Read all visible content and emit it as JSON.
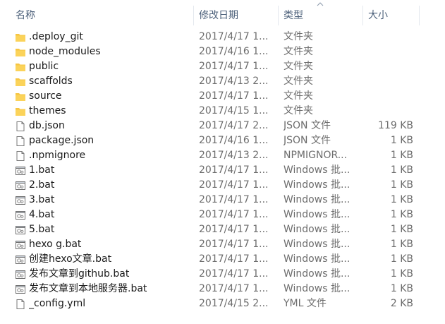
{
  "columns": {
    "name": "名称",
    "date": "修改日期",
    "type": "类型",
    "size": "大小"
  },
  "colors": {
    "header_text": "#4c607a",
    "folder": "#f6c542",
    "name_text": "#1a1a1a",
    "detail_text": "#6d6d6d"
  },
  "files": [
    {
      "name": ".deploy_git",
      "date": "2017/4/17 1...",
      "type": "文件夹",
      "size": "",
      "icon": "folder-icon"
    },
    {
      "name": "node_modules",
      "date": "2017/4/16 1...",
      "type": "文件夹",
      "size": "",
      "icon": "folder-icon"
    },
    {
      "name": "public",
      "date": "2017/4/17 1...",
      "type": "文件夹",
      "size": "",
      "icon": "folder-icon"
    },
    {
      "name": "scaffolds",
      "date": "2017/4/13 2...",
      "type": "文件夹",
      "size": "",
      "icon": "folder-icon"
    },
    {
      "name": "source",
      "date": "2017/4/17 1...",
      "type": "文件夹",
      "size": "",
      "icon": "folder-icon"
    },
    {
      "name": "themes",
      "date": "2017/4/15 1...",
      "type": "文件夹",
      "size": "",
      "icon": "folder-icon"
    },
    {
      "name": "db.json",
      "date": "2017/4/17 2...",
      "type": "JSON 文件",
      "size": "119 KB",
      "icon": "file-icon"
    },
    {
      "name": "package.json",
      "date": "2017/4/16 1...",
      "type": "JSON 文件",
      "size": "1 KB",
      "icon": "file-icon"
    },
    {
      "name": ".npmignore",
      "date": "2017/4/13 2...",
      "type": "NPMIGNOR...",
      "size": "1 KB",
      "icon": "file-icon"
    },
    {
      "name": "1.bat",
      "date": "2017/4/17 1...",
      "type": "Windows 批...",
      "size": "1 KB",
      "icon": "batch-file-icon"
    },
    {
      "name": "2.bat",
      "date": "2017/4/17 1...",
      "type": "Windows 批...",
      "size": "1 KB",
      "icon": "batch-file-icon"
    },
    {
      "name": "3.bat",
      "date": "2017/4/17 1...",
      "type": "Windows 批...",
      "size": "1 KB",
      "icon": "batch-file-icon"
    },
    {
      "name": "4.bat",
      "date": "2017/4/17 1...",
      "type": "Windows 批...",
      "size": "1 KB",
      "icon": "batch-file-icon"
    },
    {
      "name": "5.bat",
      "date": "2017/4/17 1...",
      "type": "Windows 批...",
      "size": "1 KB",
      "icon": "batch-file-icon"
    },
    {
      "name": "hexo g.bat",
      "date": "2017/4/17 1...",
      "type": "Windows 批...",
      "size": "1 KB",
      "icon": "batch-file-icon"
    },
    {
      "name": "创建hexo文章.bat",
      "date": "2017/4/17 1...",
      "type": "Windows 批...",
      "size": "1 KB",
      "icon": "batch-file-icon"
    },
    {
      "name": "发布文章到github.bat",
      "date": "2017/4/17 1...",
      "type": "Windows 批...",
      "size": "1 KB",
      "icon": "batch-file-icon"
    },
    {
      "name": "发布文章到本地服务器.bat",
      "date": "2017/4/17 1...",
      "type": "Windows 批...",
      "size": "1 KB",
      "icon": "batch-file-icon"
    },
    {
      "name": "_config.yml",
      "date": "2017/4/15 2...",
      "type": "YML 文件",
      "size": "2 KB",
      "icon": "file-icon"
    }
  ]
}
